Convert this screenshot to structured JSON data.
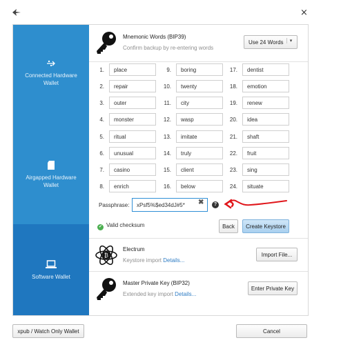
{
  "window": {
    "close_glyph": "×",
    "app_icon": "sparrow-bird-icon"
  },
  "sidebar": {
    "items": [
      {
        "label": "Connected Hardware Wallet",
        "icon": "usb-icon"
      },
      {
        "label": "Airgapped Hardware Wallet",
        "icon": "sd-card-icon"
      },
      {
        "label": "Software Wallet",
        "icon": "laptop-icon"
      }
    ]
  },
  "mnemonic": {
    "title": "Mnemonic Words (BIP39)",
    "subtitle": "Confirm backup by re-entering words",
    "word_count_select": "Use 24 Words",
    "words": [
      {
        "n": "1.",
        "w": "place"
      },
      {
        "n": "2.",
        "w": "repair"
      },
      {
        "n": "3.",
        "w": "outer"
      },
      {
        "n": "4.",
        "w": "monster"
      },
      {
        "n": "5.",
        "w": "ritual"
      },
      {
        "n": "6.",
        "w": "unusual"
      },
      {
        "n": "7.",
        "w": "casino"
      },
      {
        "n": "8.",
        "w": "enrich"
      },
      {
        "n": "9.",
        "w": "boring"
      },
      {
        "n": "10.",
        "w": "twenty"
      },
      {
        "n": "11.",
        "w": "city"
      },
      {
        "n": "12.",
        "w": "wasp"
      },
      {
        "n": "13.",
        "w": "imitate"
      },
      {
        "n": "14.",
        "w": "truly"
      },
      {
        "n": "15.",
        "w": "client"
      },
      {
        "n": "16.",
        "w": "below"
      },
      {
        "n": "17.",
        "w": "dentist"
      },
      {
        "n": "18.",
        "w": "emotion"
      },
      {
        "n": "19.",
        "w": "renew"
      },
      {
        "n": "20.",
        "w": "idea"
      },
      {
        "n": "21.",
        "w": "shaft"
      },
      {
        "n": "22.",
        "w": "fruit"
      },
      {
        "n": "23.",
        "w": "sing"
      },
      {
        "n": "24.",
        "w": "situate"
      }
    ],
    "passphrase_label": "Passphrase:",
    "passphrase_value": "xPsf5%$ed34dJ#5*",
    "valid_text": "Valid checksum",
    "back_label": "Back",
    "create_label": "Create Keystore"
  },
  "electrum": {
    "title": "Electrum",
    "subtitle": "Keystore import",
    "details": "Details...",
    "button": "Import File..."
  },
  "xprv": {
    "title": "Master Private Key (BIP32)",
    "subtitle": "Extended key import",
    "details": "Details...",
    "button": "Enter Private Key"
  },
  "footer": {
    "xpub_label": "xpub / Watch Only Wallet",
    "cancel_label": "Cancel"
  },
  "colors": {
    "sidebar": "#2e8ece",
    "sidebar_selected": "#1f77bf",
    "annotation": "#e0161b",
    "valid": "#4caf50"
  }
}
